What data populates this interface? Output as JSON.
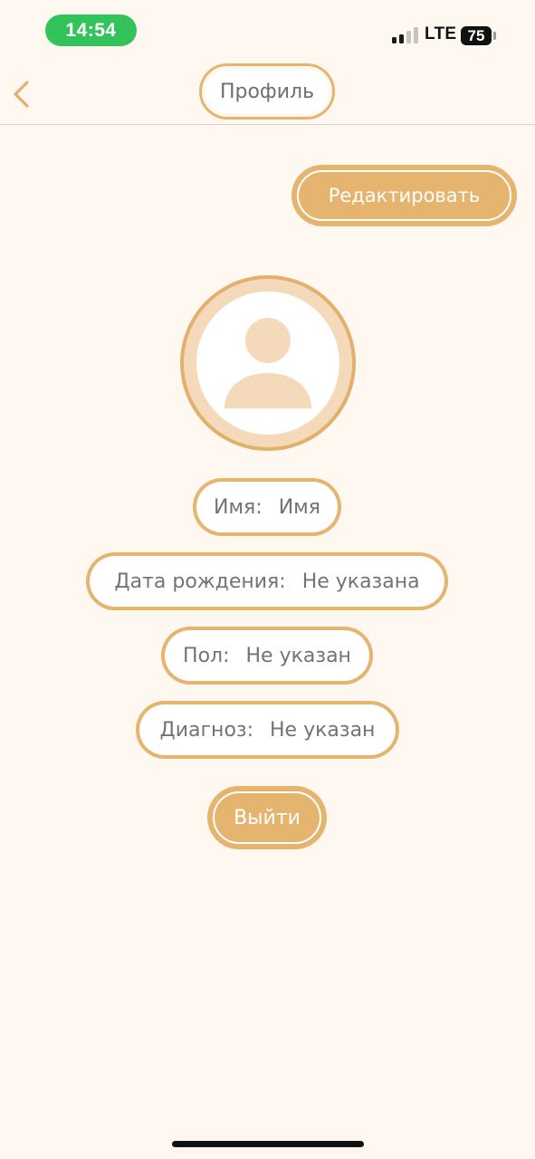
{
  "status_bar": {
    "time": "14:54",
    "network": "LTE",
    "battery": "75",
    "signal_bars_filled": 2,
    "signal_bars_total": 4
  },
  "header": {
    "back_icon": "chevron-left-icon",
    "title": "Профиль"
  },
  "actions": {
    "edit_label": "Редактировать",
    "logout_label": "Выйти"
  },
  "avatar": {
    "icon": "user-placeholder-icon"
  },
  "profile": {
    "name_label": "Имя:",
    "name_value": "Имя",
    "birth_label": "Дата рождения:",
    "birth_value": "Не указана",
    "gender_label": "Пол:",
    "gender_value": "Не указан",
    "diagnosis_label": "Диагноз:",
    "diagnosis_value": "Не указан"
  },
  "colors": {
    "background": "#FEF8F1",
    "accent": "#E5B46F",
    "avatar_ring": "#F4DABB",
    "text": "#737373",
    "status_time_pill": "#32C35A"
  }
}
